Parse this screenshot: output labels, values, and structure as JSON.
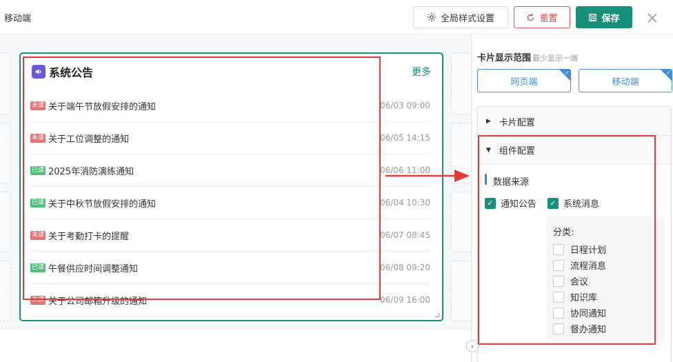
{
  "header": {
    "title": "移动端",
    "global_style_label": "全局样式设置",
    "reset_label": "重置",
    "save_label": "保存"
  },
  "card": {
    "title": "系统公告",
    "more_label": "更多",
    "notices": [
      {
        "status": "未读",
        "read": false,
        "text": "关于端午节放假安排的通知",
        "date": "06/03 09:00"
      },
      {
        "status": "未读",
        "read": false,
        "text": "关于工位调整的通知",
        "date": "06/05 14:15"
      },
      {
        "status": "已读",
        "read": true,
        "text": "2025年消防演练通知",
        "date": "06/06 11:00"
      },
      {
        "status": "已读",
        "read": true,
        "text": "关于中秋节放假安排的通知",
        "date": "06/04 10:30"
      },
      {
        "status": "未读",
        "read": false,
        "text": "关于考勤打卡的提醒",
        "date": "06/07 08:45"
      },
      {
        "status": "已读",
        "read": true,
        "text": "午餐供应时间调整通知",
        "date": "06/08 09:20"
      },
      {
        "status": "未读",
        "read": false,
        "text": "关于公司邮箱升级的通知",
        "date": "06/09 16:00"
      }
    ]
  },
  "panel": {
    "display_range_title": "卡片显示范围",
    "display_range_hint": "最少显示一端",
    "range_web": "网页端",
    "range_mobile": "移动端",
    "card_config": "卡片配置",
    "component_config": "组件配置",
    "data_source": "数据来源",
    "source_notice": "通知公告",
    "source_system": "系统消息",
    "category_label": "分类:",
    "categories": [
      "日程计划",
      "流程消息",
      "会议",
      "知识库",
      "协同通知",
      "督办通知"
    ]
  },
  "colors": {
    "accent": "#17907a",
    "danger": "#e53935",
    "link_blue": "#3e8ee0",
    "unread_tag": "#e57373",
    "read_tag": "#52c07a"
  }
}
